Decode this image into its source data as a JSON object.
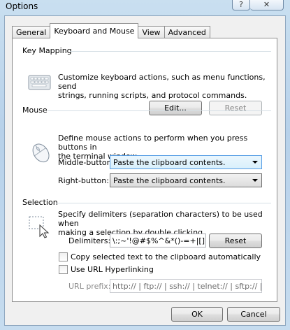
{
  "window": {
    "title": "Options",
    "help_symbol": "?",
    "close_symbol": "✕"
  },
  "tabs": [
    {
      "label": "General",
      "active": false
    },
    {
      "label": "Keyboard and Mouse",
      "active": true
    },
    {
      "label": "View",
      "active": false
    },
    {
      "label": "Advanced",
      "active": false
    }
  ],
  "key_mapping": {
    "heading": "Key Mapping",
    "description_line1": "Customize keyboard actions, such as menu functions, send",
    "description_line2": "strings, running scripts,  and protocol commands.",
    "edit_label": "Edit...",
    "reset_label": "Reset"
  },
  "mouse": {
    "heading": "Mouse",
    "description_line1": "Define mouse actions to perform when you press buttons in",
    "description_line2": "the terminal window.",
    "middle_label": "Middle-button:",
    "middle_value": "Paste the clipboard contents.",
    "right_label": "Right-button:",
    "right_value": "Paste the clipboard contents."
  },
  "selection": {
    "heading": "Selection",
    "description_line1": "Specify delimiters (separation characters) to be used when",
    "description_line2": "making a selection by double clicking.",
    "delimiters_label": "Delimiters:",
    "delimiters_value": "\\:;~'!@#$%^&*()-=+|[]{}\"',.<",
    "reset_label": "Reset",
    "copy_auto_label": "Copy selected text to the clipboard automatically",
    "copy_auto_checked": false,
    "url_label": "Use URL Hyperlinking",
    "url_checked": false,
    "url_prefix_label": "URL prefix:",
    "url_prefix_value": "http:// | ftp:// | ssh:// | telnet:// | sftp:// | rlogi"
  },
  "footer": {
    "ok_label": "OK",
    "cancel_label": "Cancel"
  }
}
